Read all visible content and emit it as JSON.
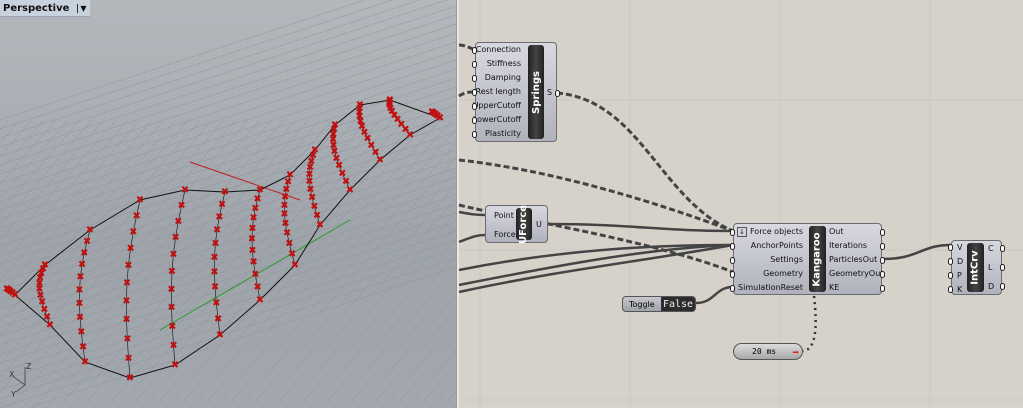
{
  "viewport": {
    "title": "Perspective",
    "axes": {
      "x": "X",
      "y": "Y",
      "z": "Z"
    }
  },
  "nodes": {
    "springs": {
      "name": "Springs",
      "inputs": [
        "Connection",
        "Stiffness",
        "Damping",
        "Rest length",
        "UpperCutoff",
        "LowerCutoff",
        "Plasticity"
      ],
      "outputs": [
        "S"
      ]
    },
    "uforce": {
      "name": "UForce",
      "inputs": [
        "Point",
        "Force"
      ],
      "outputs": [
        "U"
      ]
    },
    "kangaroo": {
      "name": "Kangaroo",
      "inputs": [
        "Force objects",
        "AnchorPoints",
        "Settings",
        "Geometry",
        "SimulationReset"
      ],
      "outputs": [
        "Out",
        "Iterations",
        "ParticlesOut",
        "GeometryOut",
        "KE"
      ]
    },
    "intcrv": {
      "name": "IntCrv",
      "inputs": [
        "V",
        "D",
        "P",
        "K"
      ],
      "outputs": [
        "C",
        "L",
        "D"
      ]
    },
    "toggle": {
      "label": "Toggle",
      "value": "False"
    },
    "timer": {
      "label": "20 ms"
    }
  },
  "colors": {
    "marker": "#c01010",
    "canvas": "#d6d2c9",
    "viewport": "#a4aab0"
  }
}
